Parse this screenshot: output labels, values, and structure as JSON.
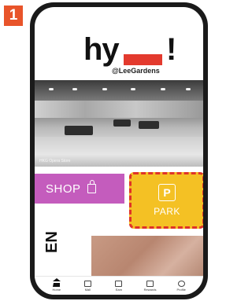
{
  "step_badge": "1",
  "header": {
    "logo_left": "hy",
    "logo_right": "!",
    "subtitle": "@LeeGardens"
  },
  "hero": {
    "caption": "HKG Opera Store"
  },
  "tiles": {
    "shop_label": "SHOP",
    "park_icon": "P",
    "park_label": "PARK"
  },
  "language_toggle": "EN",
  "bottom_nav": {
    "items": [
      {
        "label": "Home",
        "icon": "home-icon"
      },
      {
        "label": "Mall",
        "icon": "mall-icon"
      },
      {
        "label": "Earn",
        "icon": "earn-icon"
      },
      {
        "label": "Rewards",
        "icon": "rewards-icon"
      },
      {
        "label": "Profile",
        "icon": "profile-icon"
      }
    ]
  },
  "colors": {
    "badge": "#e8542a",
    "logo_bar": "#e33a2e",
    "shop_tile": "#c45cbd",
    "park_tile": "#f4c124",
    "park_highlight_border": "#e03328"
  }
}
